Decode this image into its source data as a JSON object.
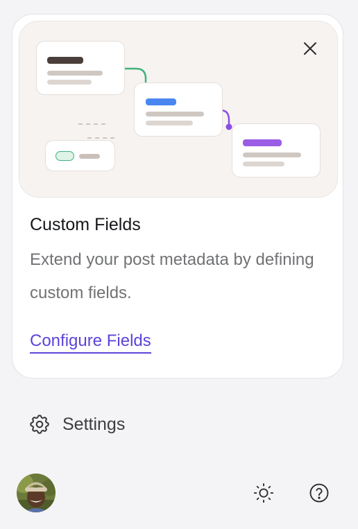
{
  "card": {
    "title": "Custom Fields",
    "description": "Extend your post metadata by defining custom fields.",
    "cta_label": "Configure Fields"
  },
  "footer": {
    "settings_label": "Settings"
  },
  "icons": {
    "close": "close-icon",
    "settings": "gear-icon",
    "theme": "sun-icon",
    "help": "help-circle-icon"
  },
  "colors": {
    "accent": "#5d43d9",
    "connector_green": "#3fb37a",
    "connector_purple": "#8b4ee0",
    "bar_blue": "#4a86f0",
    "bar_purple": "#9b5de5"
  }
}
